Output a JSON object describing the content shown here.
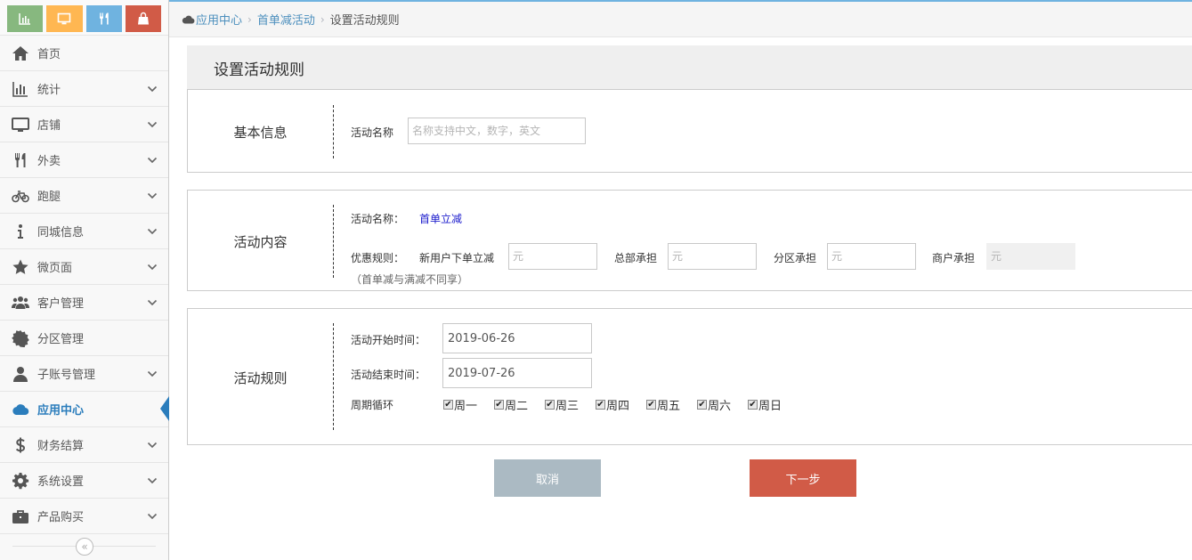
{
  "sidebar": {
    "shortcuts": [
      {
        "name": "bar-chart-icon",
        "color": "#87b87f"
      },
      {
        "name": "monitor-icon",
        "color": "#ffb752"
      },
      {
        "name": "fork-knife-icon",
        "color": "#6fb3e0"
      },
      {
        "name": "shopping-bag-icon",
        "color": "#d15b47"
      }
    ],
    "items": [
      {
        "label": "首页",
        "icon": "home-icon",
        "expandable": false
      },
      {
        "label": "统计",
        "icon": "bar-chart-icon",
        "expandable": true
      },
      {
        "label": "店铺",
        "icon": "monitor-icon",
        "expandable": true
      },
      {
        "label": "外卖",
        "icon": "fork-knife-icon",
        "expandable": true
      },
      {
        "label": "跑腿",
        "icon": "bicycle-icon",
        "expandable": true
      },
      {
        "label": "同城信息",
        "icon": "info-icon",
        "expandable": true
      },
      {
        "label": "微页面",
        "icon": "star-icon",
        "expandable": true
      },
      {
        "label": "客户管理",
        "icon": "users-icon",
        "expandable": true
      },
      {
        "label": "分区管理",
        "icon": "gear-badge-icon",
        "expandable": false
      },
      {
        "label": "子账号管理",
        "icon": "user-icon",
        "expandable": true
      },
      {
        "label": "应用中心",
        "icon": "cloud-icon",
        "expandable": false,
        "active": true
      },
      {
        "label": "财务结算",
        "icon": "dollar-icon",
        "expandable": true
      },
      {
        "label": "系统设置",
        "icon": "cog-icon",
        "expandable": true
      },
      {
        "label": "产品购买",
        "icon": "briefcase-icon",
        "expandable": true
      }
    ],
    "collapse_glyph": "«"
  },
  "breadcrumb": {
    "home": "应用中心",
    "parent": "首单减活动",
    "current": "设置活动规则"
  },
  "page_title": "设置活动规则",
  "basic_info": {
    "title": "基本信息",
    "name_label": "活动名称",
    "name_value": "",
    "name_placeholder": "名称支持中文，数字，英文"
  },
  "content": {
    "title": "活动内容",
    "name_label": "活动名称：",
    "name_value": "首单立减",
    "rule_label": "优惠规则：",
    "new_user_label": "新用户下单立减",
    "hq_label": "总部承担",
    "zone_label": "分区承担",
    "merchant_label": "商户承担",
    "unit_placeholder": "元",
    "note": "（首单减与满减不同享）"
  },
  "rules": {
    "title": "活动规则",
    "start_label": "活动开始时间：",
    "start_value": "2019-06-26",
    "end_label": "活动结束时间：",
    "end_value": "2019-07-26",
    "cycle_label": "周期循环",
    "check_glyph": "✔",
    "days": [
      {
        "label": "周一",
        "checked": true
      },
      {
        "label": "周二",
        "checked": true
      },
      {
        "label": "周三",
        "checked": true
      },
      {
        "label": "周四",
        "checked": true
      },
      {
        "label": "周五",
        "checked": true
      },
      {
        "label": "周六",
        "checked": true
      },
      {
        "label": "周日",
        "checked": true
      }
    ]
  },
  "actions": {
    "cancel": "取消",
    "next": "下一步"
  }
}
